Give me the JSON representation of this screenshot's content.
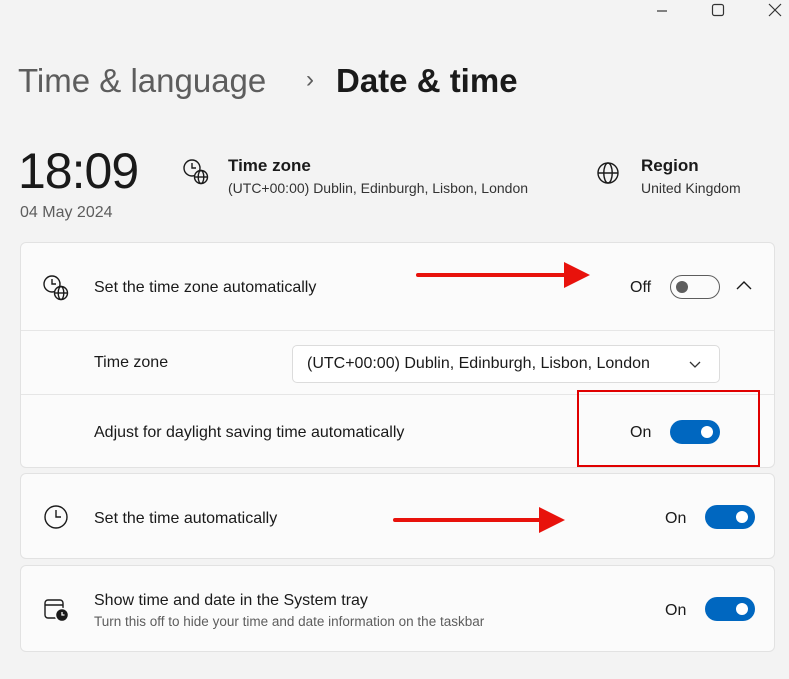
{
  "breadcrumb": {
    "parent": "Time & language",
    "separator": "›",
    "current": "Date & time"
  },
  "clock": {
    "time": "18:09",
    "date": "04 May 2024"
  },
  "timezone_info": {
    "title": "Time zone",
    "value": "(UTC+00:00) Dublin, Edinburgh, Lisbon, London"
  },
  "region_info": {
    "title": "Region",
    "value": "United Kingdom"
  },
  "auto_timezone": {
    "label": "Set the time zone automatically",
    "state": "Off",
    "toggle_value": false
  },
  "timezone_setting": {
    "label": "Time zone",
    "selected": "(UTC+00:00) Dublin, Edinburgh, Lisbon, London"
  },
  "daylight": {
    "label": "Adjust for daylight saving time automatically",
    "state": "On",
    "toggle_value": true
  },
  "auto_time": {
    "label": "Set the time automatically",
    "state": "On",
    "toggle_value": true
  },
  "systray": {
    "label": "Show time and date in the System tray",
    "sublabel": "Turn this off to hide your time and date information on the taskbar",
    "state": "On",
    "toggle_value": true
  },
  "colors": {
    "accent": "#0067c0",
    "annotation": "#e8120c"
  }
}
